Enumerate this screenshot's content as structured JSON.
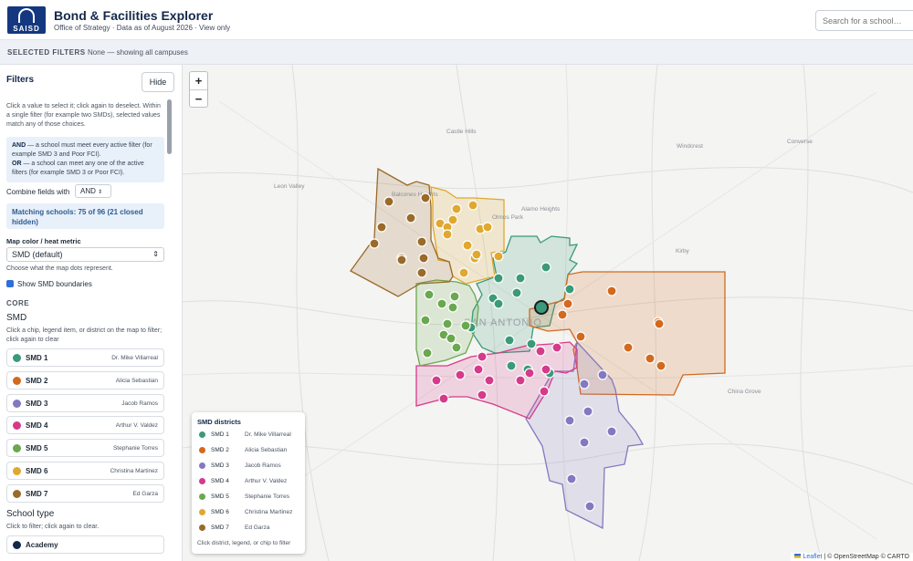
{
  "header": {
    "logo_text": "SAISD",
    "title": "Bond & Facilities Explorer",
    "subtitle": "Office of Strategy · Data as of August 2026 · View only",
    "search_placeholder": "Search for a school…"
  },
  "filters_bar": {
    "label": "SELECTED FILTERS",
    "value": "None — showing all campuses"
  },
  "sidebar": {
    "title": "Filters",
    "hide_label": "Hide",
    "intro": "Click a value to select it; click again to deselect. Within a single filter (for example two SMDs), selected values match any of those choices.",
    "and_key": "AND",
    "and_text": " — a school must meet every active filter (for example SMD 3 and Poor FCI).",
    "or_key": "OR",
    "or_text": " — a school can meet any one of the active filters (for example SMD 3 or Poor FCI).",
    "combine_label": "Combine fields with",
    "combine_value": "AND",
    "matching": "Matching schools: 75 of 96 (21 closed hidden)",
    "metric_label": "Map color / heat metric",
    "metric_value": "SMD (default)",
    "metric_hint": "Choose what the map dots represent.",
    "show_boundaries": "Show SMD boundaries",
    "section_core": "CORE",
    "smd_heading": "SMD",
    "smd_hint": "Click a chip, legend item, or district on the map to filter; click again to clear",
    "school_type_heading": "School type",
    "school_type_hint": "Click to filter; click again to clear.",
    "school_type_first": "Academy"
  },
  "smds": [
    {
      "name": "SMD 1",
      "trustee": "Dr. Mike Villarreal",
      "color": "#3a9a7a"
    },
    {
      "name": "SMD 2",
      "trustee": "Alicia Sebastian",
      "color": "#d2691e"
    },
    {
      "name": "SMD 3",
      "trustee": "Jacob Ramos",
      "color": "#8478c0"
    },
    {
      "name": "SMD 4",
      "trustee": "Arthur V. Valdez",
      "color": "#d63a8a"
    },
    {
      "name": "SMD 5",
      "trustee": "Stephanie Torres",
      "color": "#6aa84f"
    },
    {
      "name": "SMD 6",
      "trustee": "Christina Martinez",
      "color": "#e0a82e"
    },
    {
      "name": "SMD 7",
      "trustee": "Ed Garza",
      "color": "#9a6a2a"
    }
  ],
  "map": {
    "zoom_in": "+",
    "zoom_out": "−",
    "city_label": "SAN ANTONIO",
    "places": [
      "Castle Hills",
      "Windcrest",
      "Converse",
      "Leon Valley",
      "Balcones Heights",
      "Alamo Heights",
      "Olmos Park",
      "Kirby",
      "China Grove"
    ],
    "legend_title": "SMD districts",
    "legend_footer": "Click district, legend, or chip to filter",
    "attribution_leaflet": "Leaflet",
    "attribution_rest": " | © OpenStreetMap © CARTO"
  }
}
